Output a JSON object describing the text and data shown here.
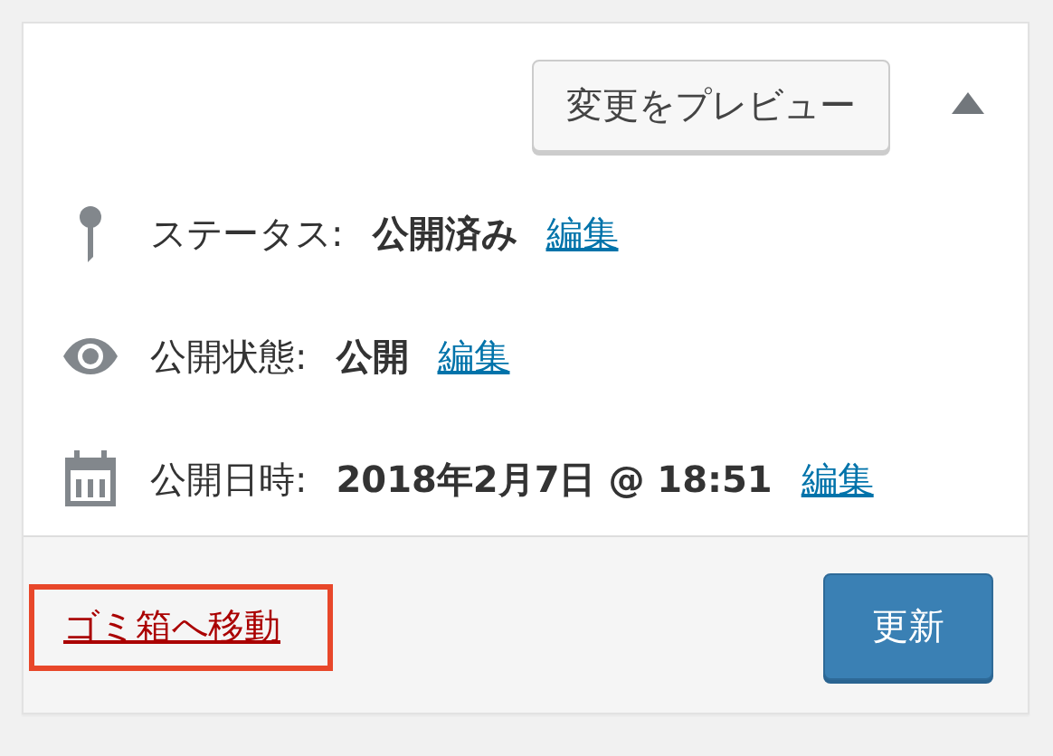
{
  "preview_button": "変更をプレビュー",
  "collapsed": false,
  "meta": [
    {
      "kind": "status",
      "label": "ステータス:",
      "value": "公開済み",
      "edit": "編集"
    },
    {
      "kind": "visibility",
      "label": "公開状態:",
      "value": "公開",
      "edit": "編集"
    },
    {
      "kind": "date",
      "label": "公開日時:",
      "value": "2018年2月7日 @ 18:51",
      "edit": "編集"
    }
  ],
  "trash_link": {
    "label": "ゴミ箱へ移動",
    "highlighted": true
  },
  "update_button": "更新"
}
